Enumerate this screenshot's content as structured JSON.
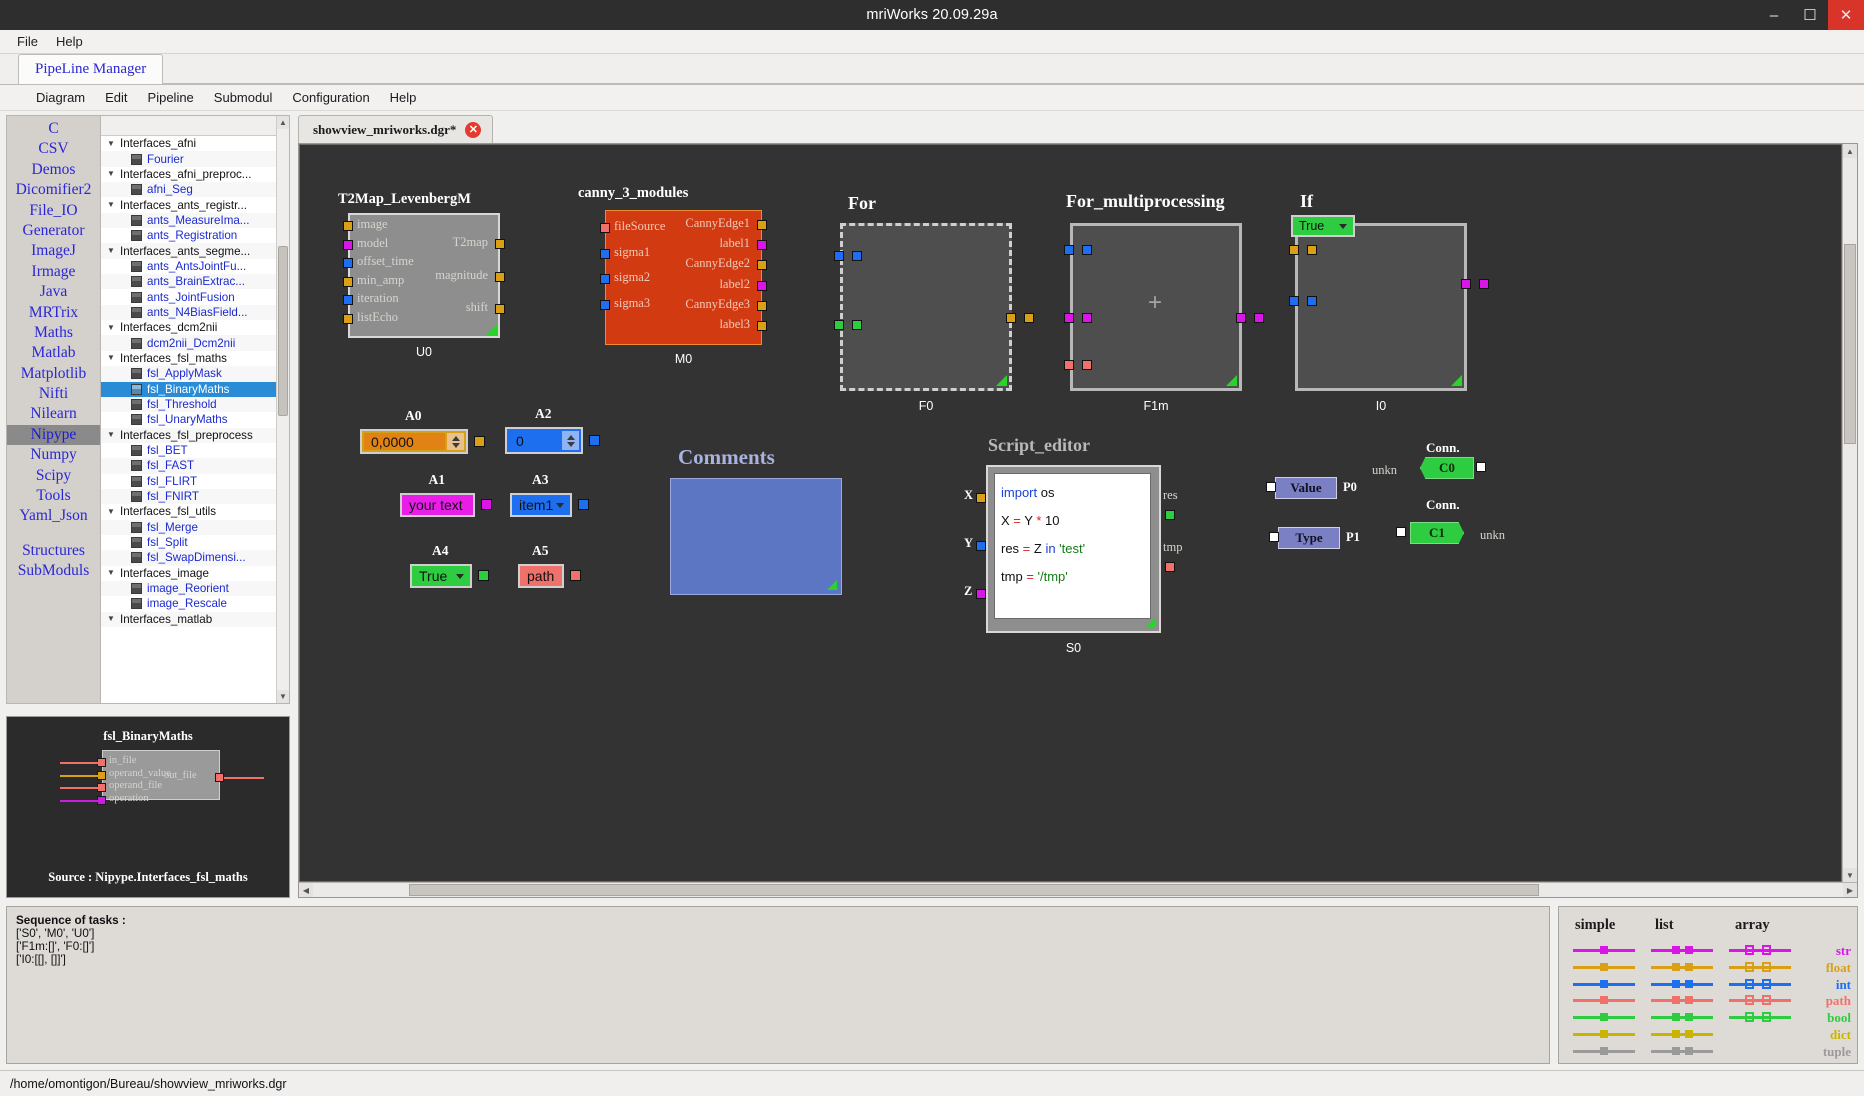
{
  "window": {
    "title": "mriWorks 20.09.29a",
    "minimize": "–",
    "maximize": "☐",
    "close": "✕"
  },
  "menubar": {
    "items": [
      "File",
      "Help"
    ]
  },
  "tabs": {
    "active": "PipeLine Manager"
  },
  "submenu": {
    "items": [
      "Diagram",
      "Edit",
      "Pipeline",
      "Submodul",
      "Configuration",
      "Help"
    ]
  },
  "categories": {
    "items": [
      "C",
      "CSV",
      "Demos",
      "Dicomifier2",
      "File_IO",
      "Generator",
      "ImageJ",
      "Irmage",
      "Java",
      "MRTrix",
      "Maths",
      "Matlab",
      "Matplotlib",
      "Nifti",
      "Nilearn",
      "Nipype",
      "Numpy",
      "Scipy",
      "Tools",
      "Yaml_Json"
    ],
    "selected": "Nipype",
    "footer": [
      "Structures",
      "SubModuls"
    ]
  },
  "tree": {
    "rows": [
      {
        "label": "Interfaces_afni",
        "type": "group"
      },
      {
        "label": "Fourier",
        "type": "leaf"
      },
      {
        "label": "Interfaces_afni_preproc...",
        "type": "group"
      },
      {
        "label": "afni_Seg",
        "type": "leaf"
      },
      {
        "label": "Interfaces_ants_registr...",
        "type": "group"
      },
      {
        "label": "ants_MeasureIma...",
        "type": "leaf"
      },
      {
        "label": "ants_Registration",
        "type": "leaf"
      },
      {
        "label": "Interfaces_ants_segme...",
        "type": "group"
      },
      {
        "label": "ants_AntsJointFu...",
        "type": "leaf"
      },
      {
        "label": "ants_BrainExtrac...",
        "type": "leaf"
      },
      {
        "label": "ants_JointFusion",
        "type": "leaf"
      },
      {
        "label": "ants_N4BiasField...",
        "type": "leaf"
      },
      {
        "label": "Interfaces_dcm2nii",
        "type": "group"
      },
      {
        "label": "dcm2nii_Dcm2nii",
        "type": "leaf"
      },
      {
        "label": "Interfaces_fsl_maths",
        "type": "group"
      },
      {
        "label": "fsl_ApplyMask",
        "type": "leaf"
      },
      {
        "label": "fsl_BinaryMaths",
        "type": "leaf",
        "selected": true
      },
      {
        "label": "fsl_Threshold",
        "type": "leaf"
      },
      {
        "label": "fsl_UnaryMaths",
        "type": "leaf"
      },
      {
        "label": "Interfaces_fsl_preprocess",
        "type": "group"
      },
      {
        "label": "fsl_BET",
        "type": "leaf"
      },
      {
        "label": "fsl_FAST",
        "type": "leaf"
      },
      {
        "label": "fsl_FLIRT",
        "type": "leaf"
      },
      {
        "label": "fsl_FNIRT",
        "type": "leaf"
      },
      {
        "label": "Interfaces_fsl_utils",
        "type": "group"
      },
      {
        "label": "fsl_Merge",
        "type": "leaf"
      },
      {
        "label": "fsl_Split",
        "type": "leaf"
      },
      {
        "label": "fsl_SwapDimensi...",
        "type": "leaf"
      },
      {
        "label": "Interfaces_image",
        "type": "group"
      },
      {
        "label": "image_Reorient",
        "type": "leaf"
      },
      {
        "label": "image_Rescale",
        "type": "leaf"
      },
      {
        "label": "Interfaces_matlab",
        "type": "group"
      }
    ]
  },
  "preview": {
    "title": "fsl_BinaryMaths",
    "source": "Source : Nipype.Interfaces_fsl_maths",
    "inputs": [
      {
        "label": "in_file",
        "color": "#f0706b"
      },
      {
        "label": "operand_value",
        "color": "#d9a017"
      },
      {
        "label": "operand_file",
        "color": "#f0706b"
      },
      {
        "label": "operation",
        "color": "#c81ee0"
      }
    ],
    "outputs": [
      {
        "label": "out_file",
        "color": "#f0706b"
      }
    ]
  },
  "document": {
    "tab_label": "showview_mriworks.dgr*",
    "close_glyph": "✕"
  },
  "canvas": {
    "nodes": [
      {
        "id": "U0",
        "title": "T2Map_LevenbergM",
        "name": "U0",
        "style": "gray",
        "inputs": [
          {
            "label": "image",
            "color": "#d9a017"
          },
          {
            "label": "model",
            "color": "#d915e8"
          },
          {
            "label": "offset_time",
            "color": "#1e6ff0"
          },
          {
            "label": "min_amp",
            "color": "#d9a017"
          },
          {
            "label": "iteration",
            "color": "#1e6ff0"
          },
          {
            "label": "listEcho",
            "color": "#d9a017"
          }
        ],
        "outputs": [
          {
            "label": "T2map",
            "color": "#d9a017"
          },
          {
            "label": "magnitude",
            "color": "#d9a017"
          },
          {
            "label": "shift",
            "color": "#d9a017"
          }
        ]
      },
      {
        "id": "M0",
        "title": "canny_3_modules",
        "name": "M0",
        "style": "orange",
        "inputs": [
          {
            "label": "fileSource",
            "color": "#f0706b"
          },
          {
            "label": "sigma1",
            "color": "#1e6ff0"
          },
          {
            "label": "sigma2",
            "color": "#1e6ff0"
          },
          {
            "label": "sigma3",
            "color": "#1e6ff0"
          }
        ],
        "outputs": [
          {
            "label": "CannyEdge1",
            "color": "#d9a017"
          },
          {
            "label": "label1",
            "color": "#d915e8"
          },
          {
            "label": "CannyEdge2",
            "color": "#d9a017"
          },
          {
            "label": "label2",
            "color": "#d915e8"
          },
          {
            "label": "CannyEdge3",
            "color": "#d9a017"
          },
          {
            "label": "label3",
            "color": "#d9a017"
          }
        ]
      }
    ],
    "containers": [
      {
        "id": "F0",
        "title": "For",
        "name": "F0"
      },
      {
        "id": "F1m",
        "title": "For_multiprocessing",
        "name": "F1m"
      },
      {
        "id": "I0",
        "title": "If",
        "name": "I0",
        "combo": "True"
      }
    ],
    "widgets": [
      {
        "id": "A0",
        "label": "A0",
        "kind": "spin",
        "value": "0,0000",
        "color": "#e08214",
        "port": "#d9a017"
      },
      {
        "id": "A1",
        "label": "A1",
        "kind": "text",
        "value": "your text",
        "color": "#e81ee8",
        "port": "#d915e8"
      },
      {
        "id": "A2",
        "label": "A2",
        "kind": "spin",
        "value": "0",
        "color": "#1e6ff0",
        "port": "#1e6ff0"
      },
      {
        "id": "A3",
        "label": "A3",
        "kind": "combo",
        "value": "item1",
        "color": "#1e6ff0",
        "port": "#1e6ff0"
      },
      {
        "id": "A4",
        "label": "A4",
        "kind": "combo",
        "value": "True",
        "color": "#2ecc40",
        "port": "#2ecc40"
      },
      {
        "id": "A5",
        "label": "A5",
        "kind": "text",
        "value": "path",
        "color": "#f0706b",
        "port": "#f0706b"
      }
    ],
    "comments": {
      "title": "Comments",
      "body": ""
    },
    "script_editor": {
      "title": "Script_editor",
      "name": "S0",
      "inputs": [
        {
          "label": "X",
          "color": "#d9a017"
        },
        {
          "label": "Y",
          "color": "#1e6ff0"
        },
        {
          "label": "Z",
          "color": "#d915e8"
        }
      ],
      "outputs": [
        {
          "label": "res",
          "color": "#2ecc40"
        },
        {
          "label": "tmp",
          "color": "#f0706b"
        }
      ],
      "code": [
        [
          {
            "t": "import",
            "c": "blue"
          },
          {
            "t": " os",
            "c": "blk"
          }
        ],
        [
          {
            "t": "X ",
            "c": "blk"
          },
          {
            "t": "=",
            "c": "red"
          },
          {
            "t": " Y ",
            "c": "blk"
          },
          {
            "t": "*",
            "c": "red"
          },
          {
            "t": " 10",
            "c": "blk"
          }
        ],
        [
          {
            "t": "res ",
            "c": "blk"
          },
          {
            "t": "=",
            "c": "red"
          },
          {
            "t": " Z ",
            "c": "blk"
          },
          {
            "t": "in",
            "c": "blue"
          },
          {
            "t": " 'test'",
            "c": "grn"
          }
        ],
        [
          {
            "t": "tmp ",
            "c": "blk"
          },
          {
            "t": "=",
            "c": "red"
          },
          {
            "t": " '/tmp'",
            "c": "grn"
          }
        ]
      ]
    },
    "connectors": [
      {
        "id": "P0",
        "label": "Value",
        "name": "P0"
      },
      {
        "id": "P1",
        "label": "Type",
        "name": "P1"
      },
      {
        "id": "C0",
        "title": "Conn.",
        "label": "C0",
        "side": "unkn"
      },
      {
        "id": "C1",
        "title": "Conn.",
        "label": "C1",
        "side": "unkn"
      }
    ]
  },
  "tasks": {
    "header": "Sequence of tasks :",
    "lines": [
      "['S0', 'M0', 'U0']",
      "['F1m:[]', 'F0:[]']",
      "['I0:[[], []]']"
    ]
  },
  "legend": {
    "columns": [
      "simple",
      "list",
      "array"
    ],
    "types": [
      {
        "name": "str",
        "color": "#d915e8"
      },
      {
        "name": "float",
        "color": "#d9a017"
      },
      {
        "name": "int",
        "color": "#1e6ff0"
      },
      {
        "name": "path",
        "color": "#f0706b"
      },
      {
        "name": "bool",
        "color": "#2ecc40"
      },
      {
        "name": "dict",
        "color": "#c9b400"
      },
      {
        "name": "tuple",
        "color": "#9a9a9a"
      }
    ]
  },
  "status": {
    "path": "/home/omontigon/Bureau/showview_mriworks.dgr"
  }
}
